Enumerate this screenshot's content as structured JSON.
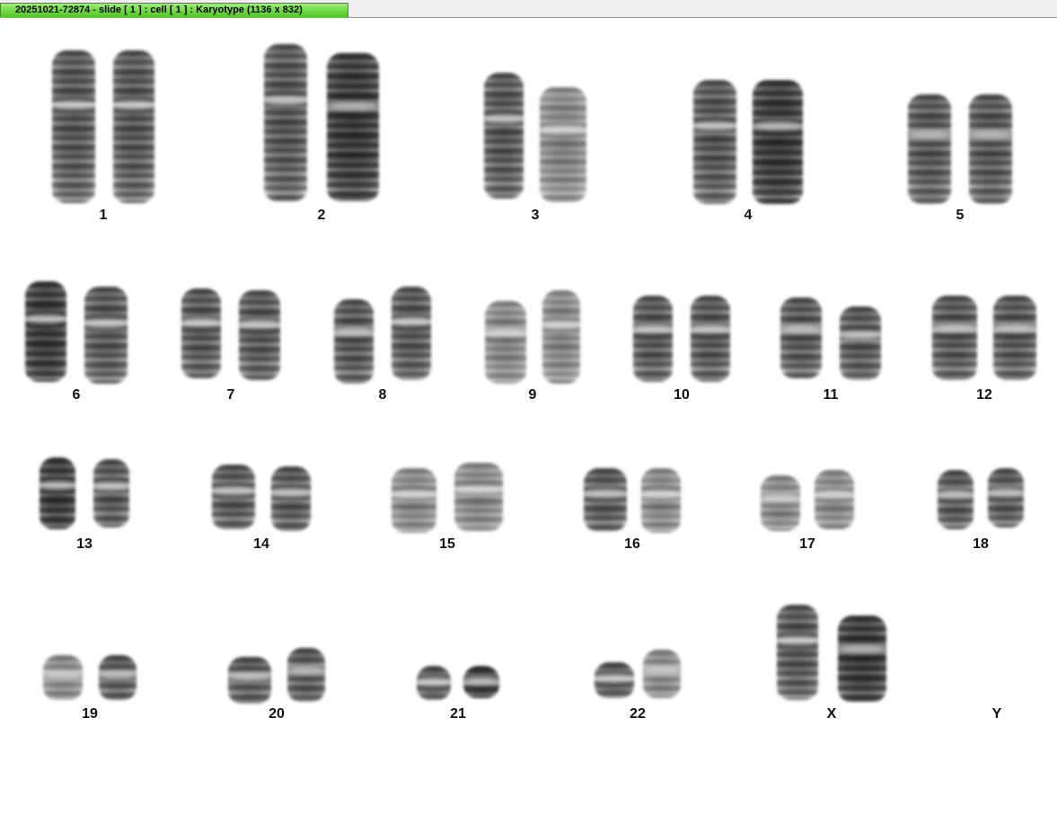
{
  "window": {
    "title": "20251021-72874 - slide [ 1 ] : cell [ 1 ] : Karyotype  (1136 x 832)",
    "tab_color": "#6fd844"
  },
  "karyotype": {
    "chromosomes": [
      {
        "label": "1"
      },
      {
        "label": "2"
      },
      {
        "label": "3"
      },
      {
        "label": "4"
      },
      {
        "label": "5"
      },
      {
        "label": "6"
      },
      {
        "label": "7"
      },
      {
        "label": "8"
      },
      {
        "label": "9"
      },
      {
        "label": "10"
      },
      {
        "label": "11"
      },
      {
        "label": "12"
      },
      {
        "label": "13"
      },
      {
        "label": "14"
      },
      {
        "label": "15"
      },
      {
        "label": "16"
      },
      {
        "label": "17"
      },
      {
        "label": "18"
      },
      {
        "label": "19"
      },
      {
        "label": "20"
      },
      {
        "label": "21"
      },
      {
        "label": "22"
      },
      {
        "label": "X"
      },
      {
        "label": "Y"
      }
    ]
  }
}
